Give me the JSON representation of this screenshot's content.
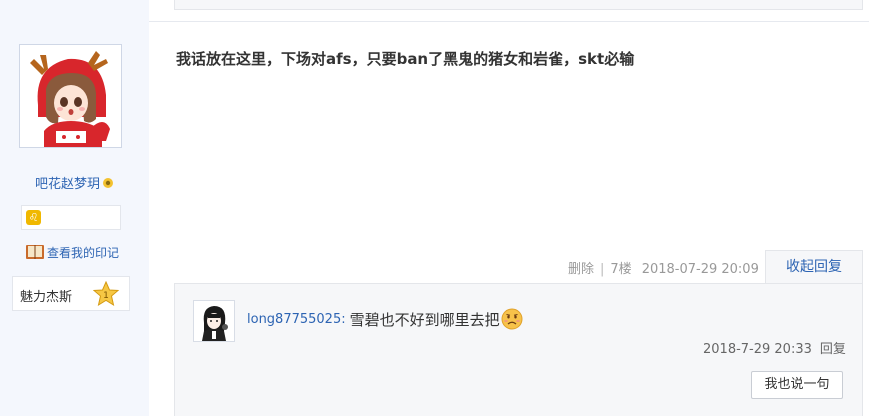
{
  "author": {
    "username": "吧花赵梦玥",
    "mark_link_label": "查看我的印记",
    "level_icon": "♌",
    "badge": {
      "label": "魅力杰斯",
      "number": "1"
    }
  },
  "post": {
    "content": "我话放在这里，下场对afs，只要ban了黑鬼的猪女和岩雀，skt必输",
    "tail": {
      "delete_label": "删除",
      "floor": "7楼",
      "datetime": "2018-07-29 20:09"
    },
    "collapse_label": "收起回复"
  },
  "reply": {
    "username": "long87755025:",
    "text": "雪碧也不好到哪里去把",
    "datetime": "2018-7-29 20:33",
    "reply_label": "回复",
    "say_button_label": "我也说一句"
  },
  "colors": {
    "link": "#2d64b3",
    "sidebar_bg": "#f4f7fd",
    "reply_bg": "#f6f7f9"
  }
}
